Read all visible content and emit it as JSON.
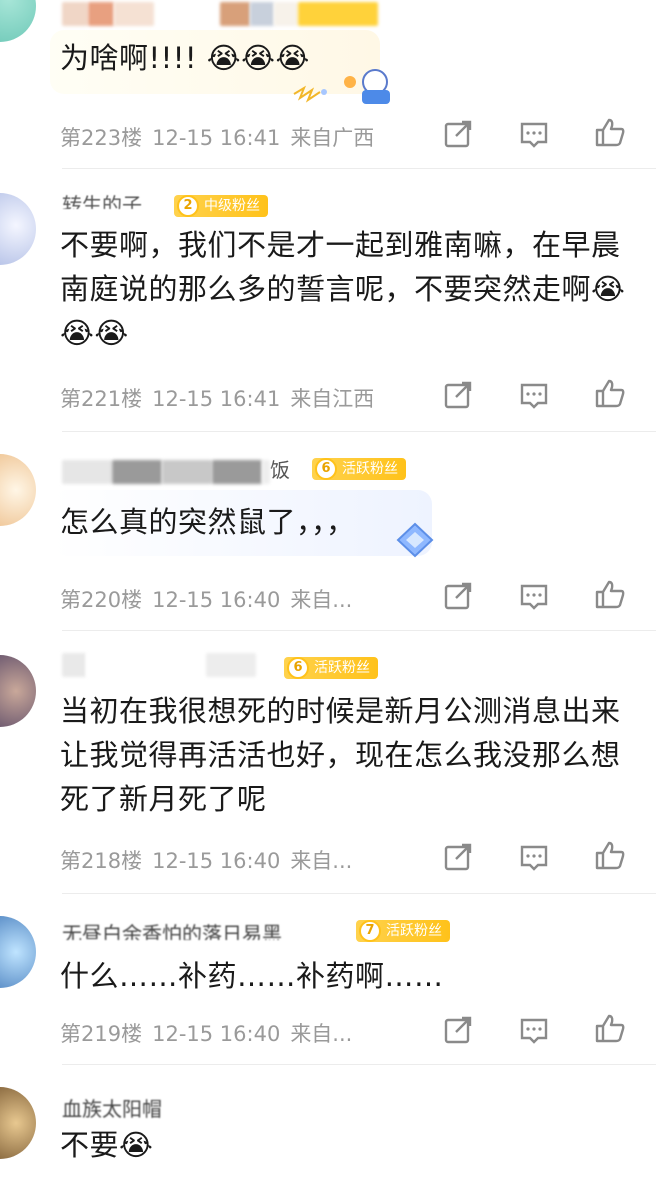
{
  "posts": [
    {
      "username_visible": "",
      "badge": null,
      "content": "为啥啊!!!! 😭😭😭",
      "floor": "第223楼",
      "time": "12-15 16:41",
      "location": "来自广西"
    },
    {
      "username_visible": "转生的子",
      "badge": {
        "level": "2",
        "label": "中级粉丝"
      },
      "content": "不要啊，我们不是才一起到雅南嘛，在早晨南庭说的那么多的誓言呢，不要突然走啊😭😭😭",
      "floor": "第221楼",
      "time": "12-15 16:41",
      "location": "来自江西"
    },
    {
      "username_visible": "饭",
      "badge": {
        "level": "6",
        "label": "活跃粉丝"
      },
      "content": "怎么真的突然鼠了，，，",
      "floor": "第220楼",
      "time": "12-15 16:40",
      "location": "来自..."
    },
    {
      "username_visible": "",
      "badge": {
        "level": "6",
        "label": "活跃粉丝"
      },
      "content": "当初在我很想死的时候是新月公测消息出来让我觉得再活活也好，现在怎么我没那么想死了新月死了呢",
      "floor": "第218楼",
      "time": "12-15 16:40",
      "location": "来自..."
    },
    {
      "username_visible": "无昼白余香怕的落日易黑",
      "badge": {
        "level": "7",
        "label": "活跃粉丝"
      },
      "content": "什么……补药……补药啊……",
      "floor": "第219楼",
      "time": "12-15 16:40",
      "location": "来自..."
    },
    {
      "username_visible": "血族太阳帽",
      "badge": null,
      "content": "不要😭",
      "floor": "",
      "time": "",
      "location": ""
    }
  ],
  "icons": {
    "share": "share-icon",
    "comment": "comment-icon",
    "like": "thumbs-up-icon"
  }
}
